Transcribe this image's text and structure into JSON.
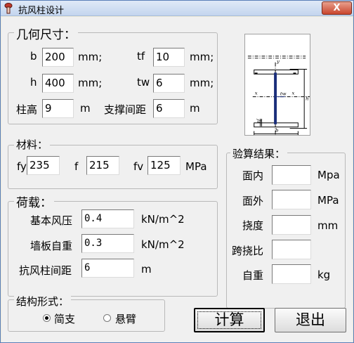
{
  "window": {
    "title": "抗风柱设计",
    "close_label": "X"
  },
  "geometry": {
    "legend": "几何尺寸：",
    "b": {
      "label": "b",
      "value": "200",
      "unit": "mm;"
    },
    "h": {
      "label": "h",
      "value": "400",
      "unit": "mm;"
    },
    "tf": {
      "label": "tf",
      "value": "10",
      "unit": "mm;"
    },
    "tw": {
      "label": "tw",
      "value": "6",
      "unit": "mm;"
    },
    "height": {
      "label": "柱高",
      "value": "9",
      "unit": "m"
    },
    "brace": {
      "label": "支撑间距",
      "value": "6",
      "unit": "m"
    }
  },
  "diagram": {
    "labels": {
      "y_top": "y",
      "y_bottom": "y",
      "x_left": "x",
      "x_right": "x",
      "tw": "tw",
      "h": "h",
      "b": "b",
      "tf": "tf"
    }
  },
  "material": {
    "legend": "材料：",
    "fy": {
      "label": "fy",
      "value": "235"
    },
    "f": {
      "label": "f",
      "value": "215"
    },
    "fv": {
      "label": "fv",
      "value": "125"
    },
    "unit": "MPa"
  },
  "load": {
    "legend": "荷载：",
    "wind": {
      "label": "基本风压",
      "value": "0.4",
      "unit": "kN/m^2"
    },
    "wall": {
      "label": "墙板自重",
      "value": "0.3",
      "unit": "kN/m^2"
    },
    "spacing": {
      "label": "抗风柱间距",
      "value": "6",
      "unit": "m"
    }
  },
  "structure": {
    "legend": "结构形式：",
    "options": [
      {
        "label": "简支",
        "checked": true
      },
      {
        "label": "悬臂",
        "checked": false
      }
    ]
  },
  "results": {
    "legend": "验算结果：",
    "in_plane": {
      "label": "面内",
      "value": "",
      "unit": "Mpa"
    },
    "out_plane": {
      "label": "面外",
      "value": "",
      "unit": "MPa"
    },
    "deflection": {
      "label": "挠度",
      "value": "",
      "unit": "mm"
    },
    "span_ratio": {
      "label": "跨挠比",
      "value": ""
    },
    "weight": {
      "label": "自重",
      "value": "",
      "unit": "kg"
    }
  },
  "buttons": {
    "calculate": "计算",
    "exit": "退出"
  }
}
